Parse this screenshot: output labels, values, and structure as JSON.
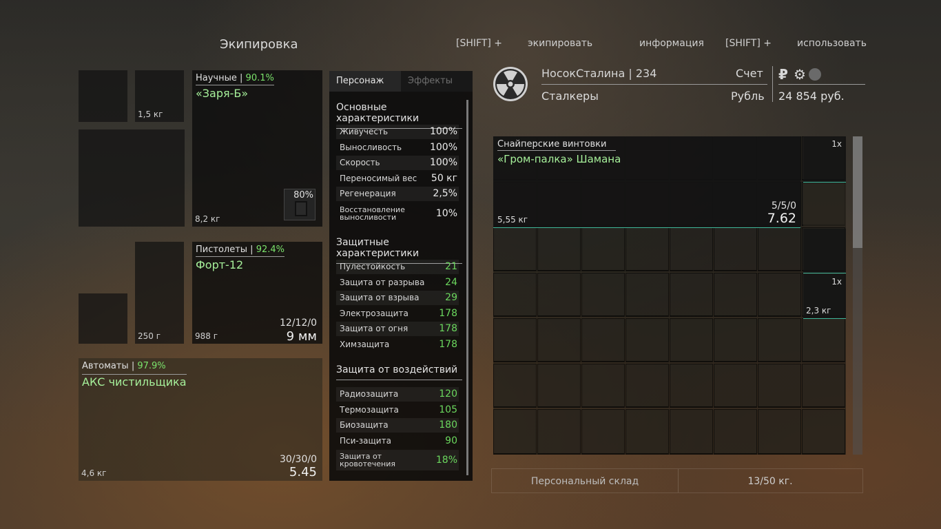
{
  "header": {
    "equipment_title": "Экипировка",
    "hints": [
      "[SHIFT] +",
      "экипировать",
      "информация",
      "[SHIFT] +",
      "использовать"
    ]
  },
  "equipment": {
    "slot_weight_small": "1,5 кг",
    "artifact_weight": "8,2 кг",
    "artifact_category": "Научные",
    "artifact_pct": "90.1%",
    "artifact_name": "«Заря-Б»",
    "artifact_badge": "80%",
    "small1_weight": "250 г",
    "pistol": {
      "weight": "988 г",
      "category": "Пистолеты",
      "pct": "92.4%",
      "name": "Форт-12",
      "ammo": "12/12/0",
      "caliber": "9 мм"
    },
    "rifle": {
      "weight": "4,6 кг",
      "category": "Автоматы",
      "pct": "97.9%",
      "name": "АКС чистильщика",
      "ammo": "30/30/0",
      "caliber": "5.45"
    }
  },
  "stats": {
    "tabs": [
      "Персонаж",
      "Эффекты"
    ],
    "sections": [
      {
        "title": "Основные характеристики",
        "rows": [
          {
            "label": "Живучесть",
            "value": "100%"
          },
          {
            "label": "Выносливость",
            "value": "100%"
          },
          {
            "label": "Скорость",
            "value": "100%"
          },
          {
            "label": "Переносимый вес",
            "value": "50 кг"
          },
          {
            "label": "Регенерация",
            "value": "2,5%"
          },
          {
            "label": "Восстановление выносливости",
            "value": "10%"
          }
        ]
      },
      {
        "title": "Защитные характеристики",
        "rows": [
          {
            "label": "Пулестойкость",
            "value": "21"
          },
          {
            "label": "Защита от разрыва",
            "value": "24"
          },
          {
            "label": "Защита от взрыва",
            "value": "29"
          },
          {
            "label": "Электрозащита",
            "value": "178"
          },
          {
            "label": "Защита от огня",
            "value": "178"
          },
          {
            "label": "Химзащита",
            "value": "178"
          }
        ]
      },
      {
        "title": "Защита от воздействий",
        "rows": [
          {
            "label": "Радиозащита",
            "value": "120"
          },
          {
            "label": "Термозащита",
            "value": "105"
          },
          {
            "label": "Биозащита",
            "value": "180"
          },
          {
            "label": "Пси-защита",
            "value": "90"
          },
          {
            "label": "Защита от кровотечения",
            "value": "18%"
          }
        ]
      }
    ]
  },
  "player": {
    "name": "НосокСталина",
    "level": "234",
    "faction": "Сталкеры",
    "account_label": "Счет",
    "currency_label": "Рубль",
    "money": "24 854 руб.",
    "currency_icon": "ruble-icon"
  },
  "inventory": {
    "sniper": {
      "category": "Снайперские винтовки",
      "name": "«Гром-палка» Шамана",
      "weight": "5,55 кг",
      "ammo": "5/5/0",
      "caliber": "7.62"
    },
    "side_top_count": "1x",
    "side_mid_count": "1x",
    "side_mid_weight": "2,3 кг"
  },
  "storage": {
    "label": "Персональный склад",
    "capacity": "13/50 кг."
  }
}
